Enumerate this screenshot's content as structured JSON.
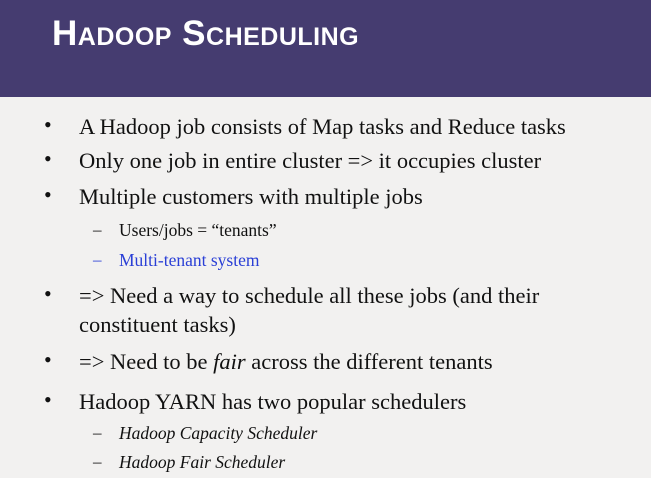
{
  "title": "Hadoop Scheduling",
  "bullets": [
    {
      "text": "A Hadoop job consists of Map tasks and Reduce tasks"
    },
    {
      "text": "Only one job in entire cluster => it occupies cluster"
    },
    {
      "text": "Multiple customers with multiple jobs"
    },
    {
      "sub": "Users/jobs = “tenants”"
    },
    {
      "sub": "Multi-tenant system",
      "color": "#2a3fd6"
    },
    {
      "line1": "=> Need a way to schedule all these jobs (and their",
      "line2": "constituent tasks)"
    },
    {
      "pre": "=> Need to be ",
      "em": "fair",
      "post": " across the different tenants"
    },
    {
      "text": "Hadoop YARN has two popular schedulers"
    },
    {
      "sub": "Hadoop Capacity Scheduler"
    },
    {
      "sub": "Hadoop Fair Scheduler"
    }
  ],
  "bullet_glyph": "•",
  "dash_glyph": "–"
}
